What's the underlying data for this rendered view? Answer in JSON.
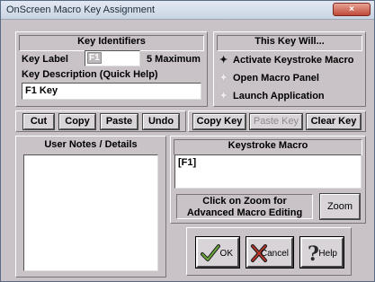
{
  "window": {
    "title": "OnScreen Macro Key Assignment",
    "close_glyph": "×"
  },
  "identifiers": {
    "title": "Key Identifiers",
    "key_label_caption": "Key Label",
    "key_label_value": "F1",
    "max_note": "5 Maximum",
    "description_caption": "Key Description (Quick Help)",
    "description_value": "F1 Key"
  },
  "this_key_will": {
    "title": "This Key Will...",
    "options": [
      {
        "label": "Activate Keystroke Macro",
        "selected": true
      },
      {
        "label": "Open Macro Panel",
        "selected": false
      },
      {
        "label": "Launch Application",
        "selected": false
      }
    ]
  },
  "edit_buttons": {
    "cut": "Cut",
    "copy": "Copy",
    "paste": "Paste",
    "undo": "Undo"
  },
  "key_buttons": {
    "copy_key": "Copy Key",
    "paste_key": "Paste Key",
    "clear_key": "Clear Key"
  },
  "notes": {
    "title": "User Notes / Details",
    "value": ""
  },
  "keystroke": {
    "title": "Keystroke Macro",
    "value": "[F1]",
    "zoom_hint_line1": "Click on Zoom for",
    "zoom_hint_line2": "Advanced Macro Editing",
    "zoom_label": "Zoom"
  },
  "actions": {
    "ok": "OK",
    "cancel": "Cancel",
    "help": "Help"
  },
  "icons": {
    "ok": "checkmark-icon",
    "cancel": "x-mark-icon",
    "help": "question-mark-icon"
  }
}
